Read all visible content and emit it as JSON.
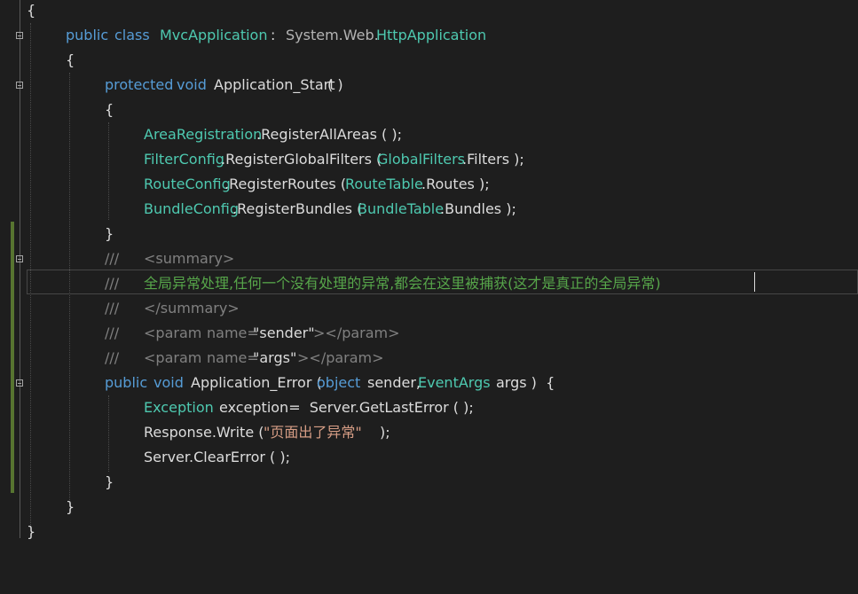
{
  "editor": {
    "language": "csharp",
    "colors": {
      "background": "#1e1e1e",
      "keyword": "#569cd6",
      "type": "#4ec9b0",
      "text": "#dcdcdc",
      "string": "#d69d85",
      "comment": "#57a64a",
      "change_bar": "#577430"
    },
    "lines": {
      "l01": {
        "t0": "{"
      },
      "l02": {
        "t0": "public",
        "t1": "class",
        "t2": "MvcApplication",
        "t3": ":",
        "t4": "System.Web.",
        "t5": "HttpApplication"
      },
      "l03": {
        "t0": "{"
      },
      "l04": {
        "t0": "protected",
        "t1": "void",
        "t2": "Application_Start",
        "t3": "( )"
      },
      "l05": {
        "t0": "{"
      },
      "l06": {
        "t0": "AreaRegistration",
        "t1": ".RegisterAllAreas ( );"
      },
      "l07": {
        "t0": "FilterConfig",
        "t1": ".RegisterGlobalFilters (",
        "t2": "GlobalFilters",
        "t3": ".Filters );"
      },
      "l08": {
        "t0": "RouteConfig",
        "t1": ".RegisterRoutes (",
        "t2": "RouteTable",
        "t3": ".Routes );"
      },
      "l09": {
        "t0": "BundleConfig",
        "t1": ".RegisterBundles (",
        "t2": "BundleTable",
        "t3": ".Bundles );"
      },
      "l10": {
        "t0": "}"
      },
      "l11": {
        "t0": "///",
        "t1": "<summary>"
      },
      "l12": {
        "t0": "///",
        "t1": "全局异常处理,任何一个没有处理的异常,都会在这里被捕获(这才是真正的全局异常)"
      },
      "l13": {
        "t0": "///",
        "t1": "</summary>"
      },
      "l14": {
        "t0": "///",
        "t1": "<param",
        "t2": "name=",
        "t3": "\"sender\"",
        "t4": "></param>"
      },
      "l15": {
        "t0": "///",
        "t1": "<param",
        "t2": "name=",
        "t3": "\"args\"",
        "t4": "></param>"
      },
      "l16": {
        "t0": "public",
        "t1": "void",
        "t2": "Application_Error (",
        "t3": "object",
        "t4": "sender,",
        "t5": "EventArgs",
        "t6": "args )  {"
      },
      "l17": {
        "t0": "Exception",
        "t1": "exception=  Server.GetLastError ( );"
      },
      "l18": {
        "t0": "Response.Write (",
        "t1": "\"页面出了异常\"",
        "t2": ");"
      },
      "l19": {
        "t0": "Server.ClearError ( );"
      },
      "l20": {
        "t0": "}"
      },
      "l21": {
        "t0": "}"
      },
      "l22": {
        "t0": "}"
      }
    }
  }
}
